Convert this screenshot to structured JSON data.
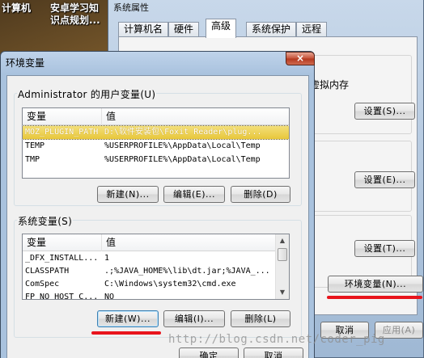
{
  "desktop": {
    "icons": [
      {
        "label_line1": "计算机",
        "label_line2": ""
      },
      {
        "label_line1": "安卓学习知",
        "label_line2": "识点规划..."
      }
    ]
  },
  "system_properties": {
    "title": "系统属性",
    "tabs": [
      "计算机名",
      "硬件",
      "高级",
      "系统保护",
      "远程"
    ],
    "active_tab": "高级",
    "virtual_memory_text": "虚拟内存",
    "settings_button_1": "设置(S)...",
    "settings_button_2": "设置(E)...",
    "settings_button_3": "设置(T)...",
    "env_vars_button": "环境变量(N)...",
    "cancel_button": "取消",
    "apply_button": "应用(A)"
  },
  "env_dialog": {
    "title": "环境变量",
    "close_icon_glyph": "×",
    "user_vars": {
      "label": "Administrator 的用户变量(U)",
      "columns": [
        "变量",
        "值"
      ],
      "rows": [
        {
          "name": "MOZ_PLUGIN_PATH",
          "value": "D:\\软件安装包\\Foxit Reader\\plug...",
          "selected": true
        },
        {
          "name": "TEMP",
          "value": "%USERPROFILE%\\AppData\\Local\\Temp",
          "selected": false
        },
        {
          "name": "TMP",
          "value": "%USERPROFILE%\\AppData\\Local\\Temp",
          "selected": false
        }
      ],
      "new_button": "新建(N)...",
      "edit_button": "编辑(E)...",
      "delete_button": "删除(D)"
    },
    "system_vars": {
      "label": "系统变量(S)",
      "columns": [
        "变量",
        "值"
      ],
      "rows": [
        {
          "name": "_DFX_INSTALL...",
          "value": "1"
        },
        {
          "name": "CLASSPATH",
          "value": ".;%JAVA_HOME%\\lib\\dt.jar;%JAVA_..."
        },
        {
          "name": "ComSpec",
          "value": "C:\\Windows\\system32\\cmd.exe"
        },
        {
          "name": "FP_NO_HOST_C...",
          "value": "NO"
        }
      ],
      "new_button": "新建(W)...",
      "edit_button": "编辑(I)...",
      "delete_button": "删除(L)"
    },
    "ok_button": "确定",
    "cancel_button": "取消"
  },
  "watermark": "http://blog.csdn.net/coder_pig",
  "colors": {
    "annotation_red": "#e8141c",
    "selection_yellow": "#e8c73b",
    "title_blue": "#a9c2de"
  }
}
